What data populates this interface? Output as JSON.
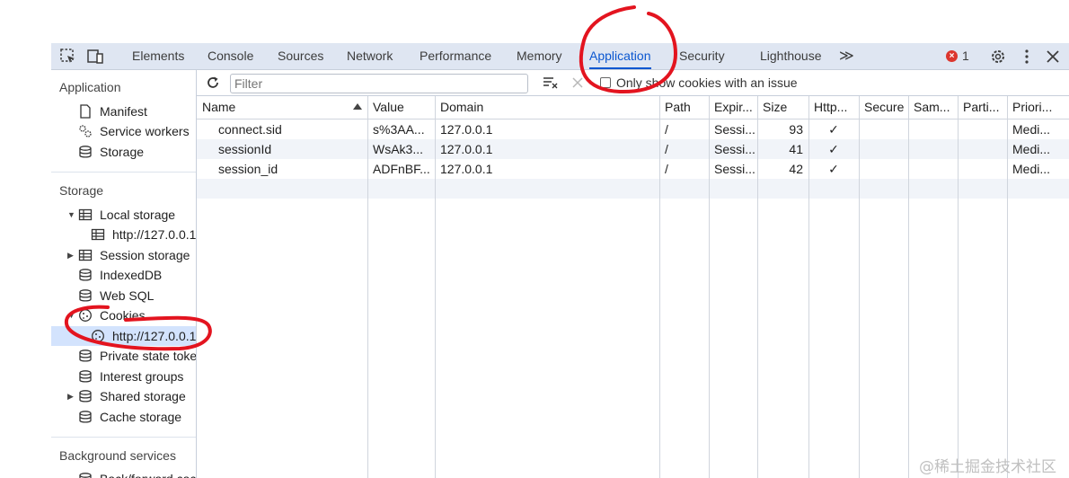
{
  "tabs": [
    "Elements",
    "Console",
    "Sources",
    "Network",
    "Performance",
    "Memory",
    "Application",
    "Security",
    "Lighthouse"
  ],
  "more_tabs": "≫",
  "error_count": "1",
  "error_icon": "×",
  "sidebar": {
    "application_title": "Application",
    "application_items": [
      "Manifest",
      "Service workers",
      "Storage"
    ],
    "storage_title": "Storage",
    "storage_items": {
      "local_storage": "Local storage",
      "local_origin": "http://127.0.0.1",
      "session_storage": "Session storage",
      "indexeddb": "IndexedDB",
      "web_sql": "Web SQL",
      "cookies": "Cookies",
      "cookie_origin": "http://127.0.0.1",
      "private_state": "Private state tokens",
      "interest_groups": "Interest groups",
      "shared_storage": "Shared storage",
      "cache_storage": "Cache storage"
    },
    "background_title": "Background services",
    "background_first": "Back/forward cache"
  },
  "toolbar": {
    "filter_placeholder": "Filter",
    "only_issue_label": "Only show cookies with an issue"
  },
  "table": {
    "headers": [
      "Name",
      "Value",
      "Domain",
      "Path",
      "Expir...",
      "Size",
      "Http...",
      "Secure",
      "Sam...",
      "Parti...",
      "Priori..."
    ],
    "rows": [
      [
        "connect.sid",
        "s%3AA...",
        "127.0.0.1",
        "/",
        "Sessi...",
        "93",
        "✓",
        "",
        "",
        "",
        "Medi..."
      ],
      [
        "sessionId",
        "WsAk3...",
        "127.0.0.1",
        "/",
        "Sessi...",
        "41",
        "✓",
        "",
        "",
        "",
        "Medi..."
      ],
      [
        "session_id",
        "ADFnBF...",
        "127.0.0.1",
        "/",
        "Sessi...",
        "42",
        "✓",
        "",
        "",
        "",
        "Medi..."
      ]
    ]
  },
  "watermark": "@稀土掘金技术社区",
  "colors": {
    "accent": "#0b57d0",
    "selected_bg": "#d3e3fd",
    "annotation": "#e3141f",
    "error": "#dc362e"
  }
}
